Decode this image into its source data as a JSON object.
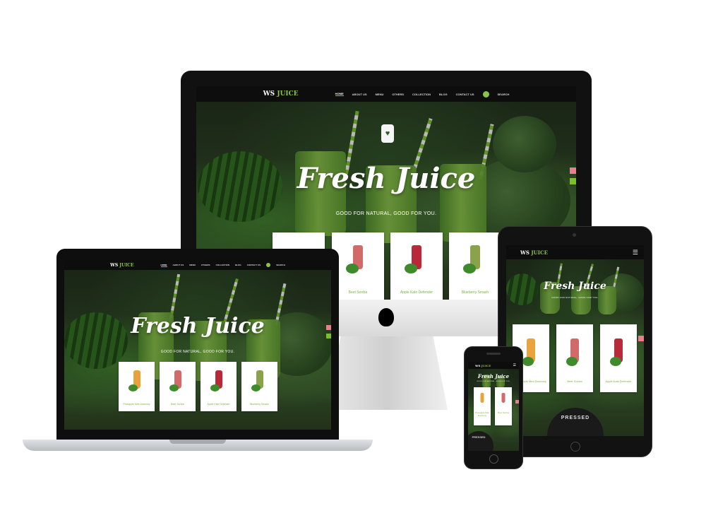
{
  "brand": {
    "logo_ws": "WS",
    "logo_juice": "JUICE"
  },
  "nav": {
    "items": [
      "HOME",
      "ABOUT US",
      "MENU",
      "OTHERS",
      "COLLECTION",
      "BLOG",
      "CONTACT US"
    ],
    "search_label": "SEARCH"
  },
  "hero": {
    "title": "Fresh Juice",
    "subtitle": "GOOD FOR NATURAL, GOOD FOR YOU."
  },
  "products": [
    {
      "name": "Pineapple Mint Darmony",
      "bottle": "#e8a33c"
    },
    {
      "name": "Beet Sorrba",
      "bottle": "#d36a6a"
    },
    {
      "name": "Apple Kale Defender",
      "bottle": "#b82a3a"
    },
    {
      "name": "Blueberry Smash",
      "bottle": "#8aa34a"
    }
  ],
  "phone_products": [
    "Pineapple Mint Darmony",
    "Beet Sorrba"
  ],
  "tablet_products": [
    "Pineapple Mint Darmony",
    "Beet Sorrba",
    "Apple Kale Defender"
  ],
  "badge": {
    "text": "PRESSED"
  },
  "colors": {
    "accent": "#8bc34a",
    "pink_tab": "#e87e8e",
    "green_tab": "#7cbf2e"
  },
  "icons": [
    "apple-logo-icon",
    "hamburger-menu-icon",
    "search-icon",
    "heart-icon"
  ]
}
